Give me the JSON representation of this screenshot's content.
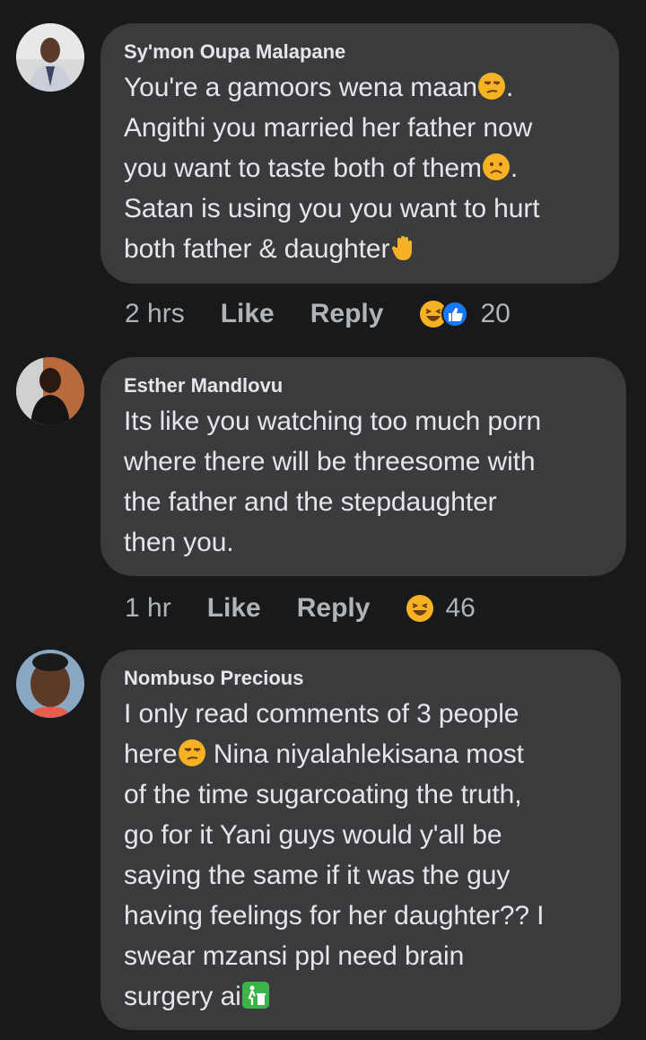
{
  "comments": [
    {
      "author": "Sy'mon Oupa Malapane",
      "lines": [
        {
          "text": "You're a gamoors wena maan",
          "emoji": "unamused-face-emoji",
          "after": "."
        },
        {
          "text": "Angithi you married her father now"
        },
        {
          "text": "you want to taste both of them",
          "emoji": "worried-face-emoji",
          "after": "."
        },
        {
          "text": "Satan is using you you want to hurt"
        },
        {
          "text": "both father & daughter",
          "emoji": "raised-hand-emoji"
        }
      ],
      "time": "2 hrs",
      "like_label": "Like",
      "reply_label": "Reply",
      "reaction_count": "20"
    },
    {
      "author": "Esther Mandlovu",
      "lines": [
        {
          "text": "Its like you watching too much porn"
        },
        {
          "text": "where there will be threesome with"
        },
        {
          "text": "the father and the stepdaughter"
        },
        {
          "text": "then you."
        }
      ],
      "time": "1 hr",
      "like_label": "Like",
      "reply_label": "Reply",
      "reaction_count": "46"
    },
    {
      "author": "Nombuso Precious",
      "lines": [
        {
          "text": "I only read comments of 3 people"
        },
        {
          "text": "here",
          "emoji": "unamused-face-emoji",
          "after": " Nina niyalahlekisana most"
        },
        {
          "text": "of the time sugarcoating the truth,"
        },
        {
          "text": "go for it Yani guys would y'all be"
        },
        {
          "text": "saying the same if it was the guy"
        },
        {
          "text": "having feelings for her daughter?? I"
        },
        {
          "text": "swear mzansi ppl need brain"
        },
        {
          "text": "surgery ai",
          "emoji": "litter-bin-emoji"
        }
      ]
    }
  ],
  "colors": {
    "background": "#18191a",
    "bubble": "#3a3b3c",
    "text": "#e4e6eb",
    "secondary_text": "#b0b3b8",
    "like_blue": "#1877f2",
    "haha_yellow": "#f7b125"
  }
}
